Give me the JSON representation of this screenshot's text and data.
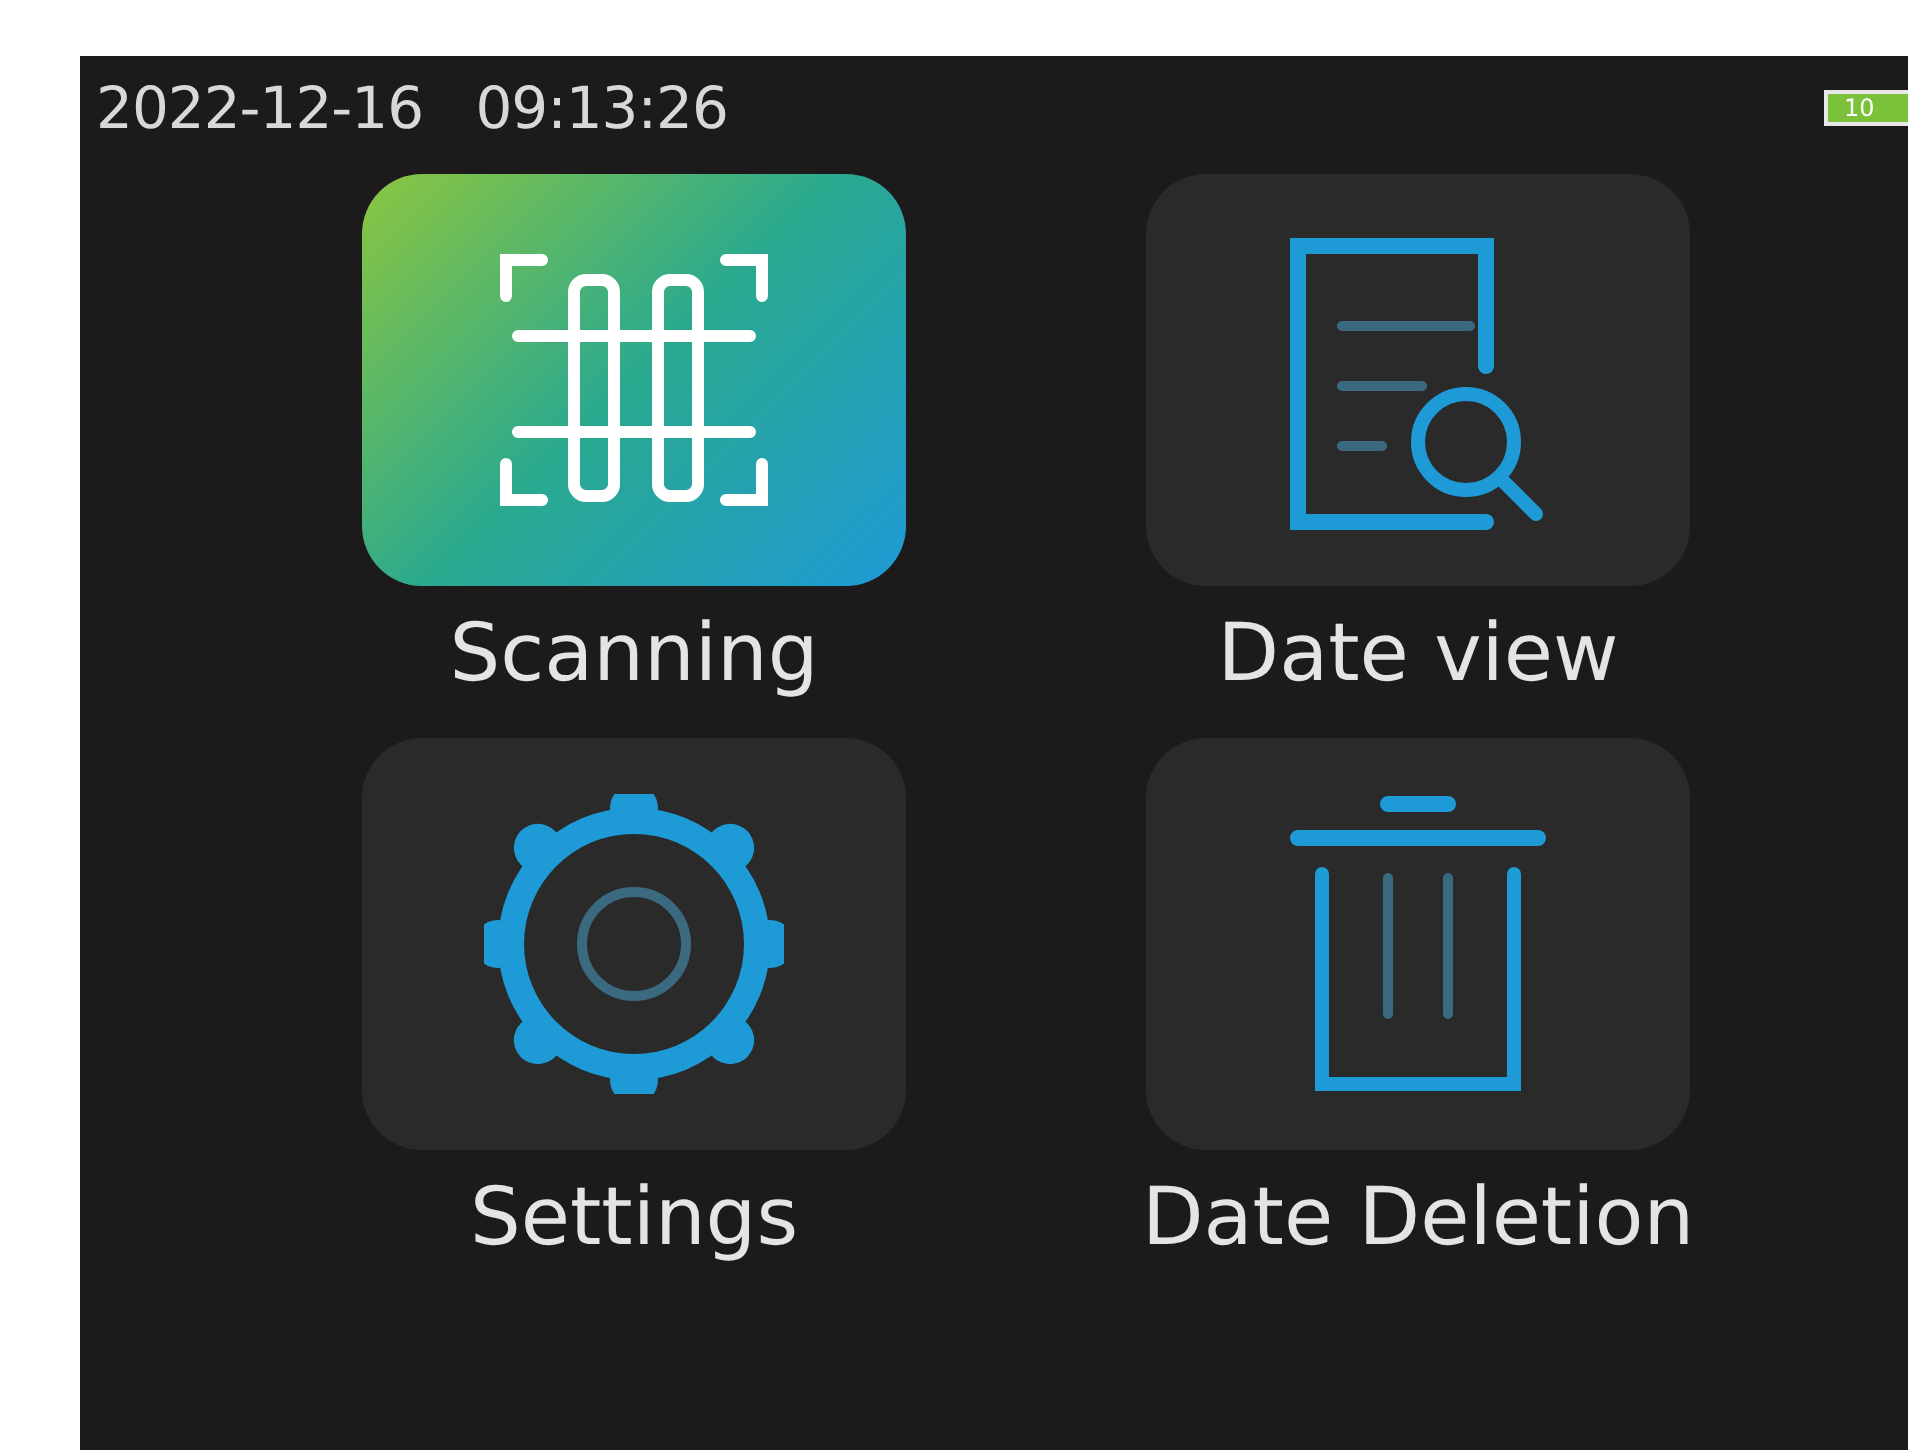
{
  "status_bar": {
    "datetime": "2022-12-16   09:13:26",
    "battery": "10"
  },
  "menu": [
    {
      "label": "Scanning",
      "kind": "scan",
      "selected": true
    },
    {
      "label": "Date view",
      "kind": "document",
      "selected": false
    },
    {
      "label": "Settings",
      "kind": "gear",
      "selected": false
    },
    {
      "label": "Date Deletion",
      "kind": "trash",
      "selected": false
    }
  ]
}
